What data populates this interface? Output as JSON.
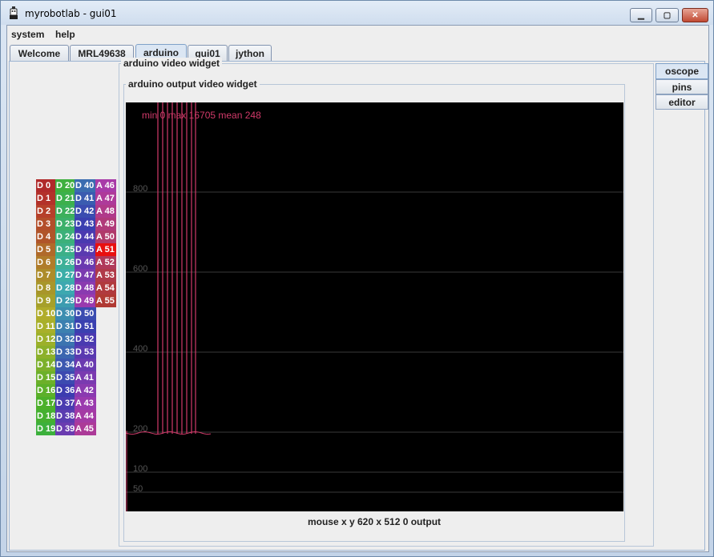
{
  "window": {
    "title": "myrobotlab - gui01",
    "controls": {
      "minimize": "▁",
      "maximize": "▢",
      "close": "✕"
    }
  },
  "menu": {
    "items": [
      "system",
      "help"
    ]
  },
  "tabs": [
    {
      "label": "Welcome",
      "active": false
    },
    {
      "label": "MRL49638",
      "active": false
    },
    {
      "label": "arduino",
      "active": true
    },
    {
      "label": "gui01",
      "active": false
    },
    {
      "label": "jython",
      "active": false
    }
  ],
  "side_tabs": [
    {
      "label": "oscope",
      "active": true
    },
    {
      "label": "pins",
      "active": false
    },
    {
      "label": "editor",
      "active": false
    }
  ],
  "widget": {
    "outer_title": "arduino  video widget",
    "inner_title": "arduino output video widget",
    "scope_stats": "min 0 max 16705 mean 248",
    "status": "mouse x y  620 x 512  0  output"
  },
  "scope": {
    "grid_labels": [
      "800",
      "600",
      "400",
      "200",
      "100",
      "50"
    ],
    "grid_values": [
      800,
      600,
      400,
      200,
      100,
      50
    ],
    "trace_color": "#d13a6a",
    "grid_color": "#3a3a3a",
    "label_color": "#555555"
  },
  "pins": {
    "columns": [
      {
        "labels": [
          "D 0",
          "D 1",
          "D 2",
          "D 3",
          "D 4",
          "D 5",
          "D 6",
          "D 7",
          "D 8",
          "D 9",
          "D 10",
          "D 11",
          "D 12",
          "D 13",
          "D 14",
          "D 15",
          "D 16",
          "D 17",
          "D 18",
          "D 19"
        ],
        "colors": [
          "#b02a2a",
          "#b3312a",
          "#b6402a",
          "#b34e2a",
          "#b0552a",
          "#b06a2a",
          "#b07c2a",
          "#ad8c2a",
          "#a8962a",
          "#a6a02a",
          "#b0ac2a",
          "#a8b02a",
          "#9cb02a",
          "#8cb02a",
          "#7cb02a",
          "#6cb02a",
          "#5cb02a",
          "#4cb02a",
          "#44b030",
          "#3cb03c"
        ]
      },
      {
        "labels": [
          "D 20",
          "D 21",
          "D 22",
          "D 23",
          "D 24",
          "D 25",
          "D 26",
          "D 27",
          "D 28",
          "D 29",
          "D 30",
          "D 31",
          "D 32",
          "D 33",
          "D 34",
          "D 35",
          "D 36",
          "D 37",
          "D 38",
          "D 39"
        ],
        "colors": [
          "#3fb03f",
          "#3cb04c",
          "#3cb05c",
          "#3cb06a",
          "#3cb07a",
          "#3cb088",
          "#3cb098",
          "#3caea8",
          "#3ca8b0",
          "#3c9cb0",
          "#3c8eb0",
          "#3c80b0",
          "#3c74b0",
          "#3c66b0",
          "#3c58b0",
          "#3c4ab0",
          "#3c3cb0",
          "#4a3cb0",
          "#5a3cb0",
          "#6a3cb0"
        ]
      },
      {
        "labels": [
          "D 40",
          "D 41",
          "D 42",
          "D 43",
          "D 44",
          "D 45",
          "D 46",
          "D 47",
          "D 48",
          "D 49",
          "D 50",
          "D 51",
          "D 52",
          "D 53",
          "A 40",
          "A 41",
          "A 42",
          "A 43",
          "A 44",
          "A 45"
        ],
        "colors": [
          "#3a6cb0",
          "#3a5cb0",
          "#3a4cb0",
          "#3a40b0",
          "#4a3ab0",
          "#5a3ab0",
          "#6a3ab0",
          "#7a3ab0",
          "#8a3ab0",
          "#9a3aae",
          "#3a4cb0",
          "#3a40b0",
          "#4a3ab0",
          "#5a3ab0",
          "#6a3ab0",
          "#7a3ab0",
          "#8a3ab0",
          "#9a3aae",
          "#a43aa4",
          "#ac3a98"
        ]
      },
      {
        "labels": [
          "A 46",
          "A 47",
          "A 48",
          "A 49",
          "A 50",
          "A 51",
          "A 52",
          "A 53",
          "A 54",
          "A 55"
        ],
        "colors": [
          "#a83aa8",
          "#ae3a9a",
          "#b03a8a",
          "#b03a7a",
          "#b03a6a",
          "#e81010",
          "#b03a5a",
          "#b03a4a",
          "#b03a3e",
          "#b03a34"
        ]
      }
    ]
  }
}
